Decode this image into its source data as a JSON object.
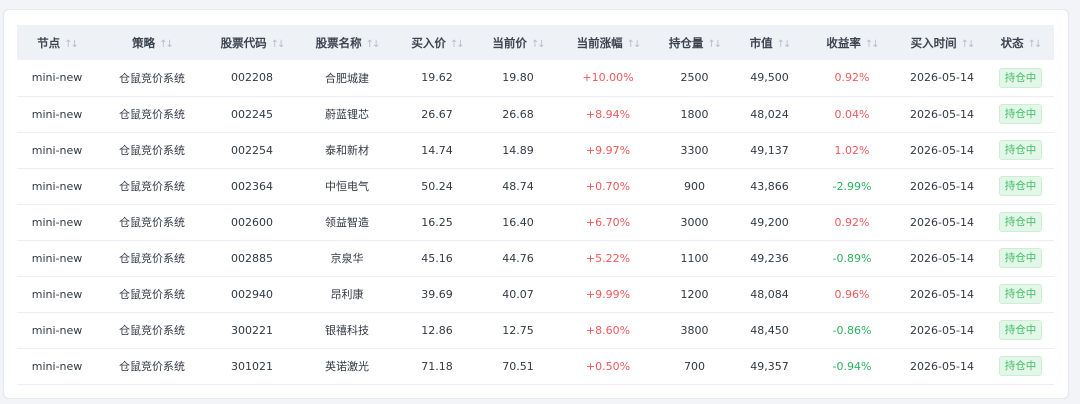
{
  "table": {
    "headers": [
      "节点",
      "策略",
      "股票代码",
      "股票名称",
      "买入价",
      "当前价",
      "当前涨幅",
      "持仓量",
      "市值",
      "收益率",
      "买入时间",
      "状态"
    ],
    "sort_icon": "sort-arrows-icon",
    "rows": [
      {
        "node": "mini-new",
        "strategy": "仓鼠竞价系统",
        "code": "002208",
        "name": "合肥城建",
        "buy_price": "19.62",
        "current_price": "19.80",
        "change": "+10.00%",
        "change_dir": "up",
        "quantity": "2500",
        "market_value": "49,500",
        "return": "0.92%",
        "return_dir": "up",
        "buy_time": "2026-05-14",
        "status": "持仓中"
      },
      {
        "node": "mini-new",
        "strategy": "仓鼠竞价系统",
        "code": "002245",
        "name": "蔚蓝锂芯",
        "buy_price": "26.67",
        "current_price": "26.68",
        "change": "+8.94%",
        "change_dir": "up",
        "quantity": "1800",
        "market_value": "48,024",
        "return": "0.04%",
        "return_dir": "up",
        "buy_time": "2026-05-14",
        "status": "持仓中"
      },
      {
        "node": "mini-new",
        "strategy": "仓鼠竞价系统",
        "code": "002254",
        "name": "泰和新材",
        "buy_price": "14.74",
        "current_price": "14.89",
        "change": "+9.97%",
        "change_dir": "up",
        "quantity": "3300",
        "market_value": "49,137",
        "return": "1.02%",
        "return_dir": "up",
        "buy_time": "2026-05-14",
        "status": "持仓中"
      },
      {
        "node": "mini-new",
        "strategy": "仓鼠竞价系统",
        "code": "002364",
        "name": "中恒电气",
        "buy_price": "50.24",
        "current_price": "48.74",
        "change": "+0.70%",
        "change_dir": "up",
        "quantity": "900",
        "market_value": "43,866",
        "return": "-2.99%",
        "return_dir": "down",
        "buy_time": "2026-05-14",
        "status": "持仓中"
      },
      {
        "node": "mini-new",
        "strategy": "仓鼠竞价系统",
        "code": "002600",
        "name": "领益智造",
        "buy_price": "16.25",
        "current_price": "16.40",
        "change": "+6.70%",
        "change_dir": "up",
        "quantity": "3000",
        "market_value": "49,200",
        "return": "0.92%",
        "return_dir": "up",
        "buy_time": "2026-05-14",
        "status": "持仓中"
      },
      {
        "node": "mini-new",
        "strategy": "仓鼠竞价系统",
        "code": "002885",
        "name": "京泉华",
        "buy_price": "45.16",
        "current_price": "44.76",
        "change": "+5.22%",
        "change_dir": "up",
        "quantity": "1100",
        "market_value": "49,236",
        "return": "-0.89%",
        "return_dir": "down",
        "buy_time": "2026-05-14",
        "status": "持仓中"
      },
      {
        "node": "mini-new",
        "strategy": "仓鼠竞价系统",
        "code": "002940",
        "name": "昂利康",
        "buy_price": "39.69",
        "current_price": "40.07",
        "change": "+9.99%",
        "change_dir": "up",
        "quantity": "1200",
        "market_value": "48,084",
        "return": "0.96%",
        "return_dir": "up",
        "buy_time": "2026-05-14",
        "status": "持仓中"
      },
      {
        "node": "mini-new",
        "strategy": "仓鼠竞价系统",
        "code": "300221",
        "name": "银禧科技",
        "buy_price": "12.86",
        "current_price": "12.75",
        "change": "+8.60%",
        "change_dir": "up",
        "quantity": "3800",
        "market_value": "48,450",
        "return": "-0.86%",
        "return_dir": "down",
        "buy_time": "2026-05-14",
        "status": "持仓中"
      },
      {
        "node": "mini-new",
        "strategy": "仓鼠竞价系统",
        "code": "301021",
        "name": "英诺激光",
        "buy_price": "71.18",
        "current_price": "70.51",
        "change": "+0.50%",
        "change_dir": "up",
        "quantity": "700",
        "market_value": "49,357",
        "return": "-0.94%",
        "return_dir": "down",
        "buy_time": "2026-05-14",
        "status": "持仓中"
      }
    ]
  },
  "colors": {
    "up": "#f0595b",
    "down": "#2bb25c",
    "status_badge_bg": "#e2f7e8",
    "status_badge_text": "#3fbf62",
    "header_bg": "#eef1f6"
  }
}
